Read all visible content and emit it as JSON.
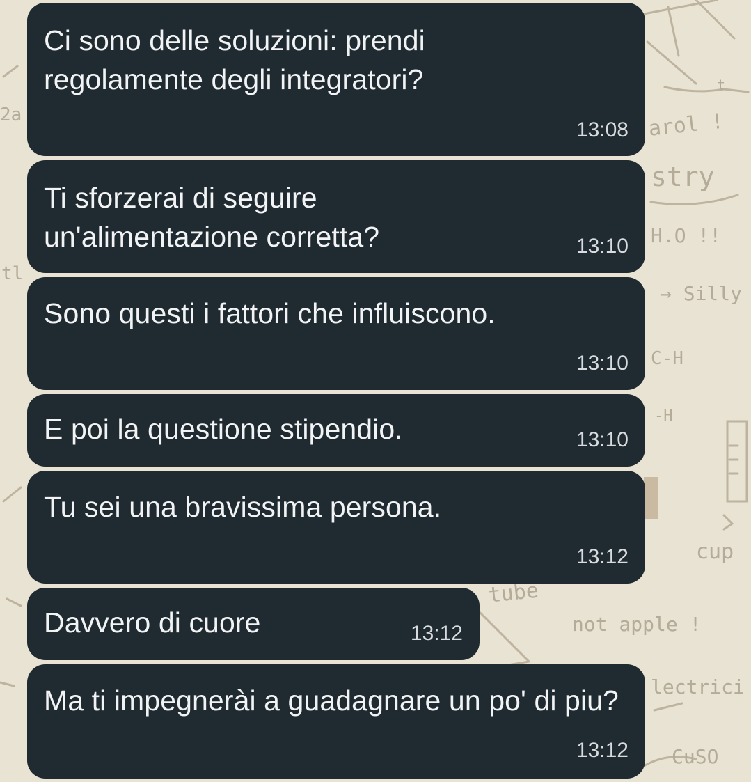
{
  "wallpaper": {
    "doodles": [
      "arol !",
      "stry",
      "H.O !!",
      "→ Silly",
      "C-H",
      "-H",
      "cup",
      "tube",
      "not apple !",
      "lectrici",
      "CuSO",
      "2a",
      "tl",
      "t"
    ]
  },
  "messages": [
    {
      "text": "Ci sono delle soluzioni: prendi regolamente degli integratori?",
      "time": "13:08"
    },
    {
      "text": "Ti sforzerai di seguire un'alimentazione corretta?",
      "time": "13:10"
    },
    {
      "text": "Sono questi i fattori che influiscono.",
      "time": "13:10"
    },
    {
      "text": "E poi la questione stipendio.",
      "time": "13:10"
    },
    {
      "text": "Tu sei una bravissima persona.",
      "time": "13:12"
    },
    {
      "text": "Davvero di cuore",
      "time": "13:12"
    },
    {
      "text": "Ma ti impegnerài a guadagnare un po' di piu?",
      "time": "13:12"
    }
  ]
}
